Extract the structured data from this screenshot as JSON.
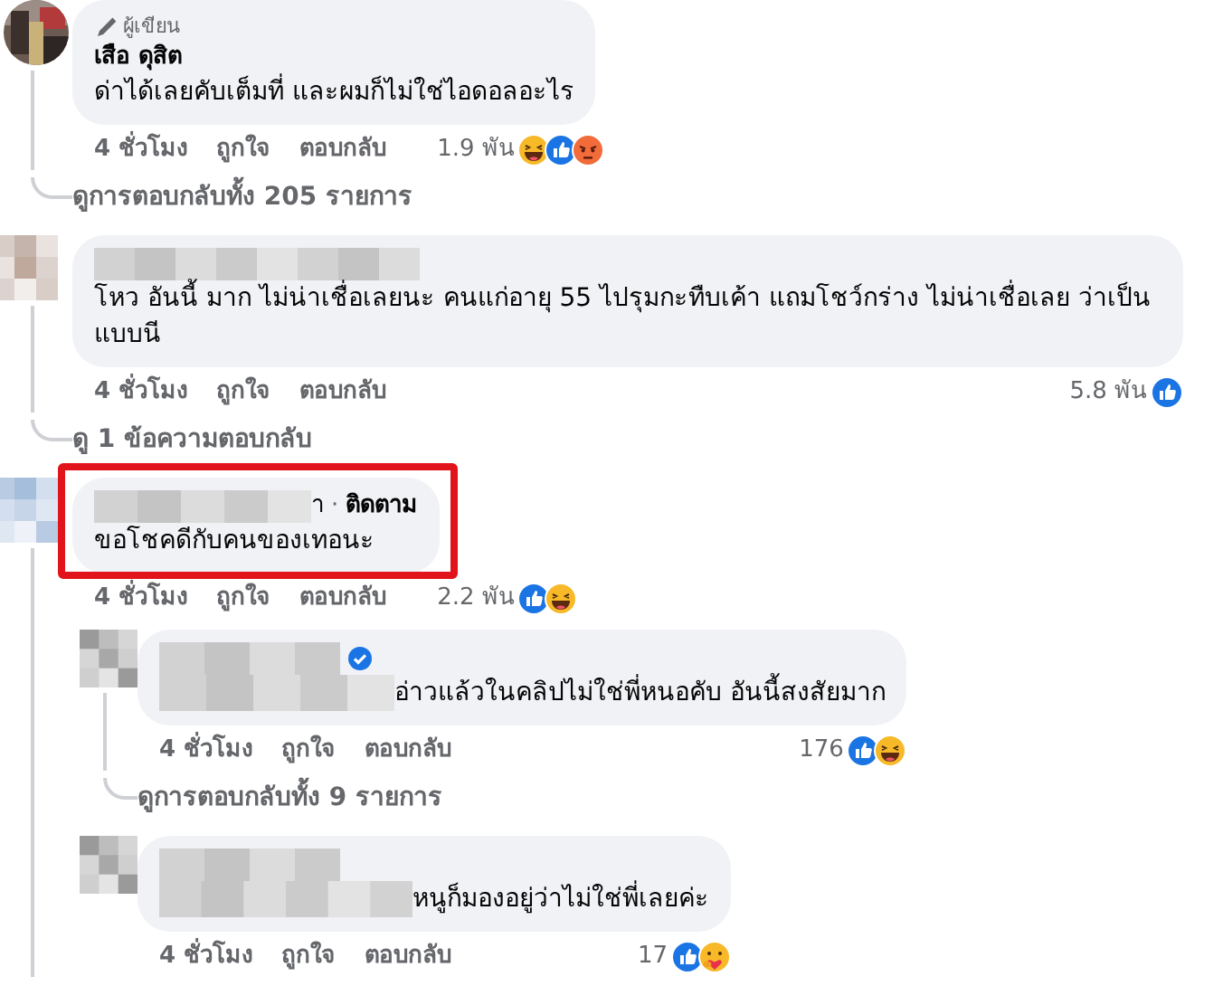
{
  "comments": [
    {
      "badge": "ผู้เขียน",
      "name": "เสือ ดุสิต",
      "name_redacted": false,
      "text": "ด่าได้เลยคับเต็มที่ และผมก็ไม่ใช่ไอดอลอะไร",
      "text_redacted_prefix": false,
      "highlighted": false,
      "time": "4 ชั่วโมง",
      "like": "ถูกใจ",
      "reply": "ตอบกลับ",
      "reaction_count": "1.9 พัน",
      "reactions": [
        {
          "kind": "haha"
        },
        {
          "kind": "like"
        },
        {
          "kind": "angry"
        }
      ],
      "view_replies": "ดูการตอบกลับทั้ง 205 รายการ"
    },
    {
      "avatar": {
        "kind": "warm"
      },
      "name_redacted": true,
      "text": "โหว อันนี้  มาก ไม่น่าเชื่อเลยนะ คนแก่อายุ 55 ไปรุมกะทืบเค้า แถมโชว์กร่าง ไม่น่าเชื่อเลย ว่าเป็นแบบนี",
      "text_redacted_prefix": false,
      "highlighted": false,
      "time": "4 ชั่วโมง",
      "like": "ถูกใจ",
      "reply": "ตอบกลับ",
      "reaction_count": "5.8 พัน",
      "reactions": [
        {
          "kind": "like"
        }
      ],
      "view_replies": "ดู 1 ข้อความตอบกลับ"
    },
    {
      "avatar": {
        "kind": "cool"
      },
      "name_redacted": true,
      "name_tail": "า",
      "separator": "·",
      "follow": "ติดตาม",
      "text": "ขอโชคดีกับคนของเทอนะ",
      "text_redacted_prefix": false,
      "highlighted": true,
      "time": "4 ชั่วโมง",
      "like": "ถูกใจ",
      "reply": "ตอบกลับ",
      "reaction_count": "2.2 พัน",
      "reactions": [
        {
          "kind": "like"
        },
        {
          "kind": "haha"
        }
      ],
      "children": [
        {
          "avatar": {
            "kind": "grey"
          },
          "name_redacted": true,
          "verified": true,
          "text": "อ่าวแล้วในคลิปไม่ใช่พี่หนอคับ อันนี้สงสัยมาก",
          "text_redacted_prefix": true,
          "highlighted": false,
          "time": "4 ชั่วโมง",
          "like": "ถูกใจ",
          "reply": "ตอบกลับ",
          "reaction_count": "176",
          "reactions": [
            {
              "kind": "like"
            },
            {
              "kind": "haha"
            }
          ],
          "view_replies": "ดูการตอบกลับทั้ง 9 รายการ"
        },
        {
          "avatar": {
            "kind": "grey"
          },
          "name_redacted": true,
          "text": "หนูก็มองอยู่ว่าไม่ใช่พี่เลยค่ะ",
          "text_redacted_prefix": true,
          "highlighted": false,
          "time": "4 ชั่วโมง",
          "like": "ถูกใจ",
          "reply": "ตอบกลับ",
          "reaction_count": "17",
          "reactions": [
            {
              "kind": "like"
            },
            {
              "kind": "care"
            }
          ]
        }
      ]
    }
  ]
}
